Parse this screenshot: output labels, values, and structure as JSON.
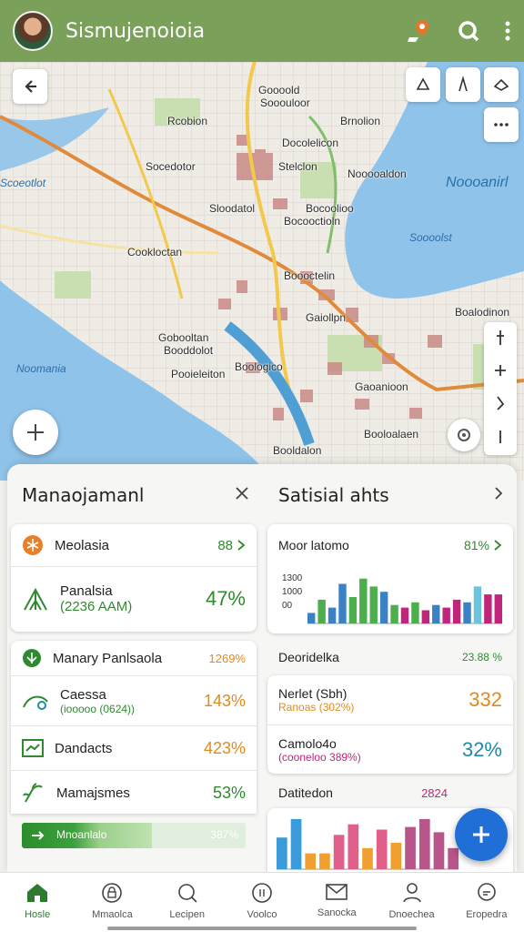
{
  "app": {
    "title": "Sismujenoioia"
  },
  "colors": {
    "accent": "#7aa05a",
    "green": "#2f8a2f",
    "orange": "#e08a1e",
    "blue": "#1f6fd6",
    "magenta": "#c0257a"
  },
  "map": {
    "labels": [
      {
        "id": "l1",
        "text": "Goooold"
      },
      {
        "id": "l2",
        "text": "Sooouloor"
      },
      {
        "id": "l3",
        "text": "Rcobion"
      },
      {
        "id": "l4",
        "text": "Docolelicon"
      },
      {
        "id": "l5",
        "text": "Brnolion"
      },
      {
        "id": "l6",
        "text": "Socedotor"
      },
      {
        "id": "l7",
        "text": "Stelclon"
      },
      {
        "id": "l8",
        "text": "Nooooaldon"
      },
      {
        "id": "l9",
        "text": "Sloodatol"
      },
      {
        "id": "l10",
        "text": "Bocoolioo"
      },
      {
        "id": "l11",
        "text": "Bocooctioln"
      },
      {
        "id": "l12",
        "text": "Cookloctan"
      },
      {
        "id": "l13",
        "text": "Boooctelin"
      },
      {
        "id": "l14",
        "text": "Gaiollpn"
      },
      {
        "id": "l15",
        "text": "Gobooltan"
      },
      {
        "id": "l16",
        "text": "Booddolot"
      },
      {
        "id": "l17",
        "text": "Pooieleiton"
      },
      {
        "id": "l18",
        "text": "Boologico"
      },
      {
        "id": "l19",
        "text": "Gaoanioon"
      },
      {
        "id": "l20",
        "text": "Booloalaen"
      },
      {
        "id": "l21",
        "text": "Booldalon"
      },
      {
        "id": "l22",
        "text": "Boalodinon"
      }
    ],
    "water_labels": [
      {
        "id": "w1",
        "text": "Noooanirl"
      },
      {
        "id": "w2",
        "text": "Soooolst"
      },
      {
        "id": "w3",
        "text": "Noomania"
      },
      {
        "id": "w4",
        "text": "Scoeotlot"
      }
    ]
  },
  "panel_left": {
    "title": "Manaojamanl",
    "card1": {
      "row1": {
        "label": "Meolasia",
        "value": "88"
      },
      "row2": {
        "label": "Panalsia",
        "sub": "(2236 AAM)",
        "value": "47%"
      }
    },
    "rows": [
      {
        "label": "Manary Panlsaola",
        "value": "1269%",
        "color": "orange",
        "icon": "check-circle-icon"
      },
      {
        "label": "Caessa",
        "sub": "(iooooo (0624))",
        "value": "143%",
        "color": "orange",
        "icon": "route-icon"
      },
      {
        "label": "Dandacts",
        "value": "423%",
        "color": "orange",
        "icon": "trend-icon"
      },
      {
        "label": "Mamajsmes",
        "value": "53%",
        "color": "green",
        "icon": "sprout-icon"
      }
    ],
    "progress": {
      "label": "Mnoanlalo",
      "value": "387%",
      "fraction": 0.58
    }
  },
  "panel_right": {
    "title": "Satisial ahts",
    "card1": {
      "label": "Moor latomo",
      "value": "81%",
      "yticks": [
        "1300",
        "1000",
        "00"
      ],
      "chart_data": {
        "type": "bar",
        "values": [
          20,
          45,
          30,
          75,
          50,
          85,
          70,
          60,
          35,
          30,
          40,
          25,
          35,
          30,
          45,
          40,
          70,
          55,
          55
        ],
        "colors": [
          "#3b82c4",
          "#4cae4c",
          "#3b82c4",
          "#3b82c4",
          "#4cae4c",
          "#4cae4c",
          "#4cae4c",
          "#3b82c4",
          "#4cae4c",
          "#c0257a",
          "#4cae4c",
          "#c0257a",
          "#3b82c4",
          "#c0257a",
          "#c0257a",
          "#3b82c4",
          "#6cc4e0",
          "#c0257a",
          "#c0257a"
        ]
      }
    },
    "header2": {
      "label": "Deoridelka",
      "value": "23.88 %"
    },
    "card2": [
      {
        "label": "Nerlet (Sbh)",
        "sub": "Ranoas (302%)",
        "value": "332",
        "color": "orange"
      },
      {
        "label": "Camolo4o",
        "sub": "(cooneloo 389%)",
        "value": "32%",
        "color": "teal"
      }
    ],
    "card3": {
      "label": "Datitedon",
      "value": "2824",
      "chart_data": {
        "type": "bar",
        "values": [
          60,
          95,
          30,
          30,
          65,
          85,
          40,
          75,
          50,
          80,
          95,
          70,
          40
        ],
        "colors": [
          "#3b9ad8",
          "#3b9ad8",
          "#f0a030",
          "#f0a030",
          "#e0608a",
          "#e0608a",
          "#f0a030",
          "#e0608a",
          "#f0a030",
          "#b8558a",
          "#b8558a",
          "#b8558a",
          "#b8558a"
        ]
      }
    }
  },
  "nav": [
    {
      "label": "Hosle",
      "icon": "home-icon"
    },
    {
      "label": "Mmaolca",
      "icon": "lock-icon"
    },
    {
      "label": "Lecipen",
      "icon": "search-icon"
    },
    {
      "label": "Voolco",
      "icon": "clock-icon"
    },
    {
      "label": "Sanocka",
      "icon": "mail-icon"
    },
    {
      "label": "Dnoechea",
      "icon": "person-icon"
    },
    {
      "label": "Eropedra",
      "icon": "chat-icon"
    }
  ]
}
